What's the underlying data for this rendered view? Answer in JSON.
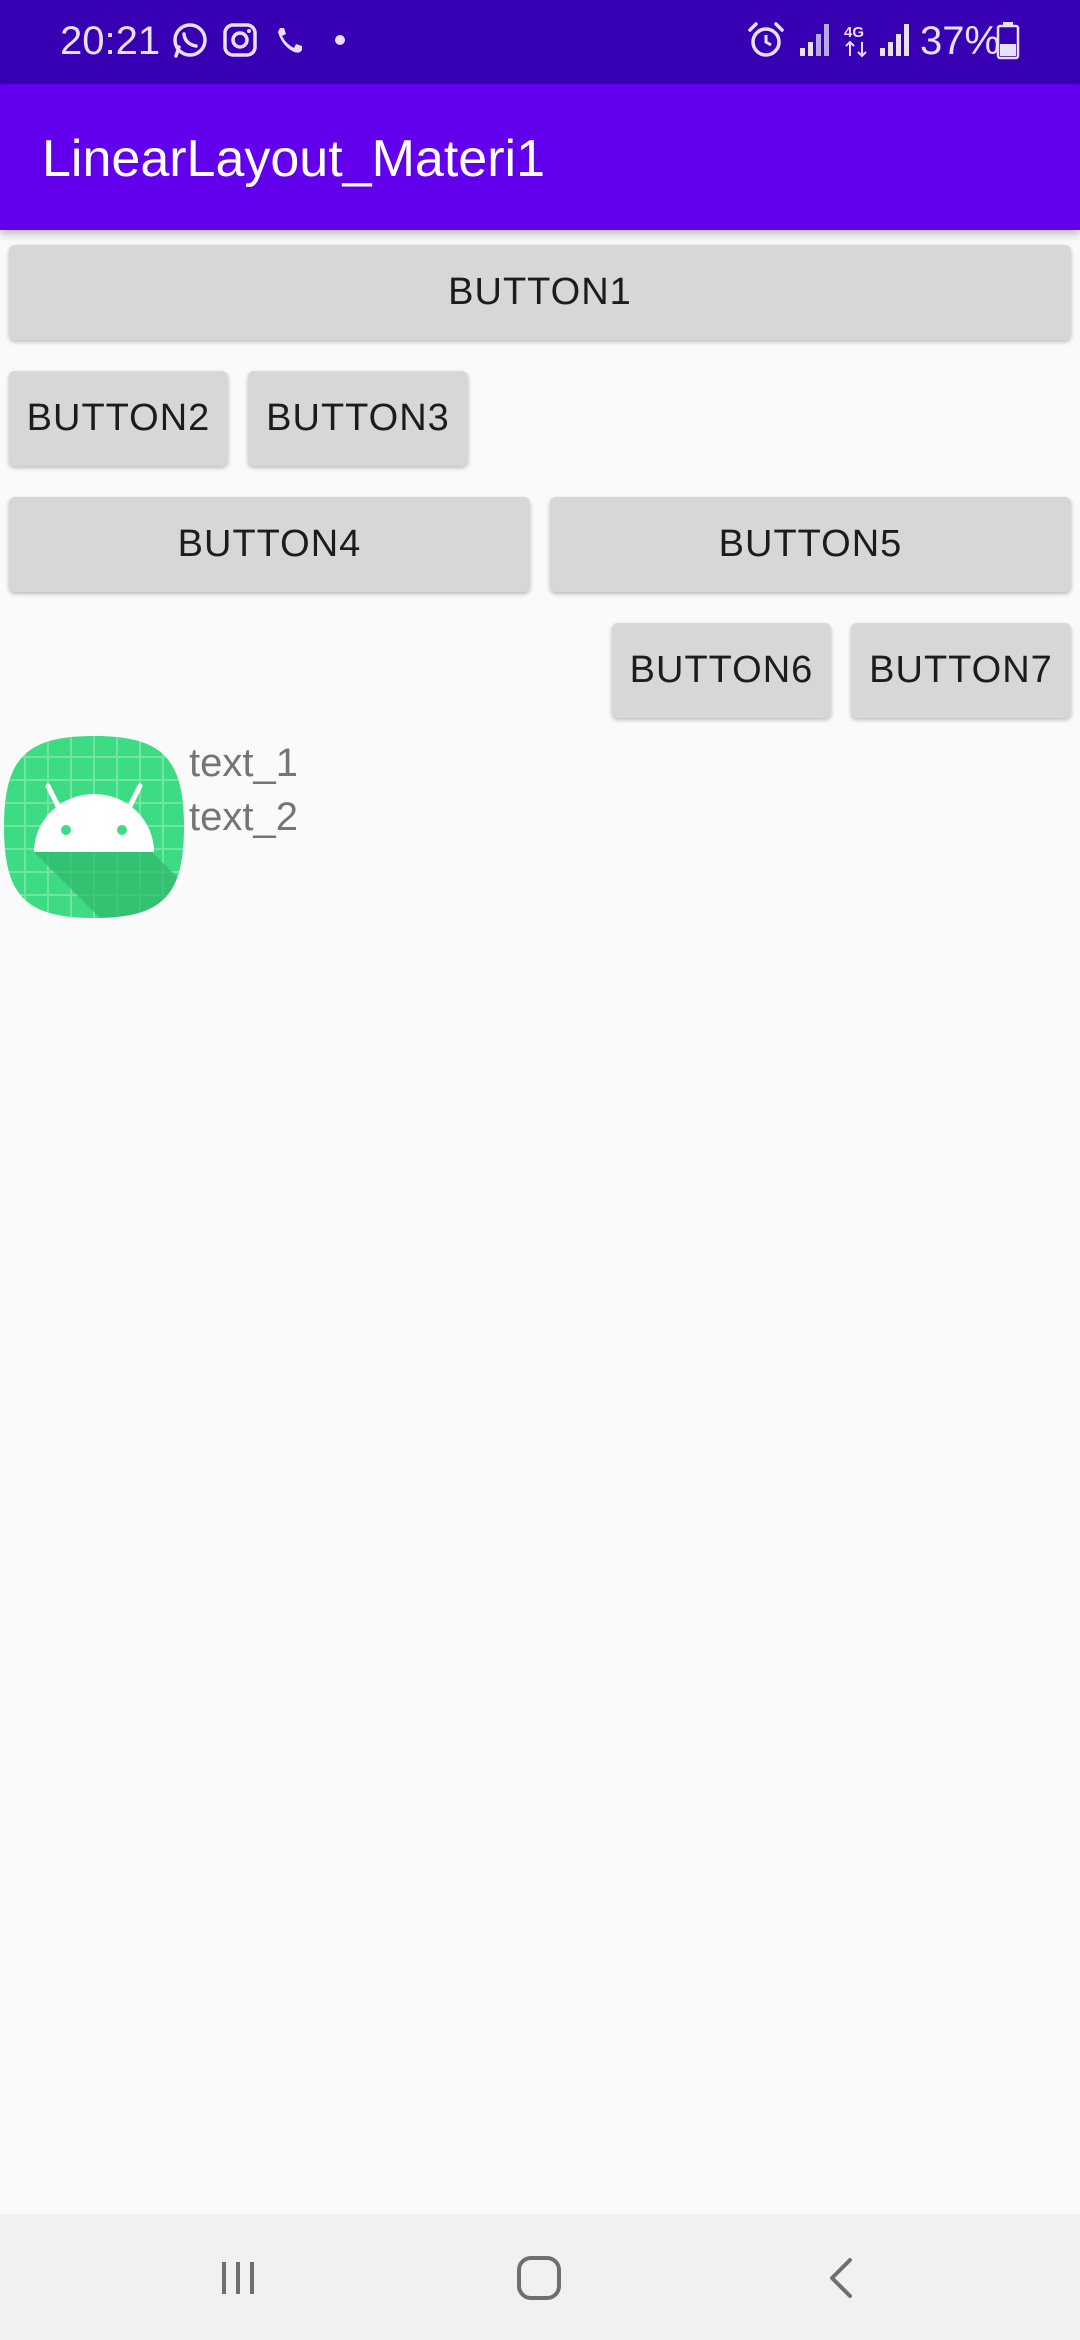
{
  "status_bar": {
    "time": "20:21",
    "battery": "37%",
    "icons": [
      "whatsapp-icon",
      "instagram-icon",
      "phone-missed-icon",
      "dot-icon",
      "alarm-icon",
      "signal-icon",
      "4g-icon",
      "signal-icon",
      "battery-icon"
    ]
  },
  "app_bar": {
    "title": "LinearLayout_Materi1"
  },
  "buttons": {
    "b1": "BUTTON1",
    "b2": "BUTTON2",
    "b3": "BUTTON3",
    "b4": "BUTTON4",
    "b5": "BUTTON5",
    "b6": "BUTTON6",
    "b7": "BUTTON7"
  },
  "content": {
    "text1": "text_1",
    "text2": "text_2"
  },
  "colors": {
    "status_bar": "#3700b3",
    "app_bar": "#6200ee",
    "button_bg": "#d6d7d7",
    "icon_green": "#3ddc84"
  },
  "nav_bar": {
    "icons": [
      "recent-apps-icon",
      "home-icon",
      "back-icon"
    ]
  }
}
